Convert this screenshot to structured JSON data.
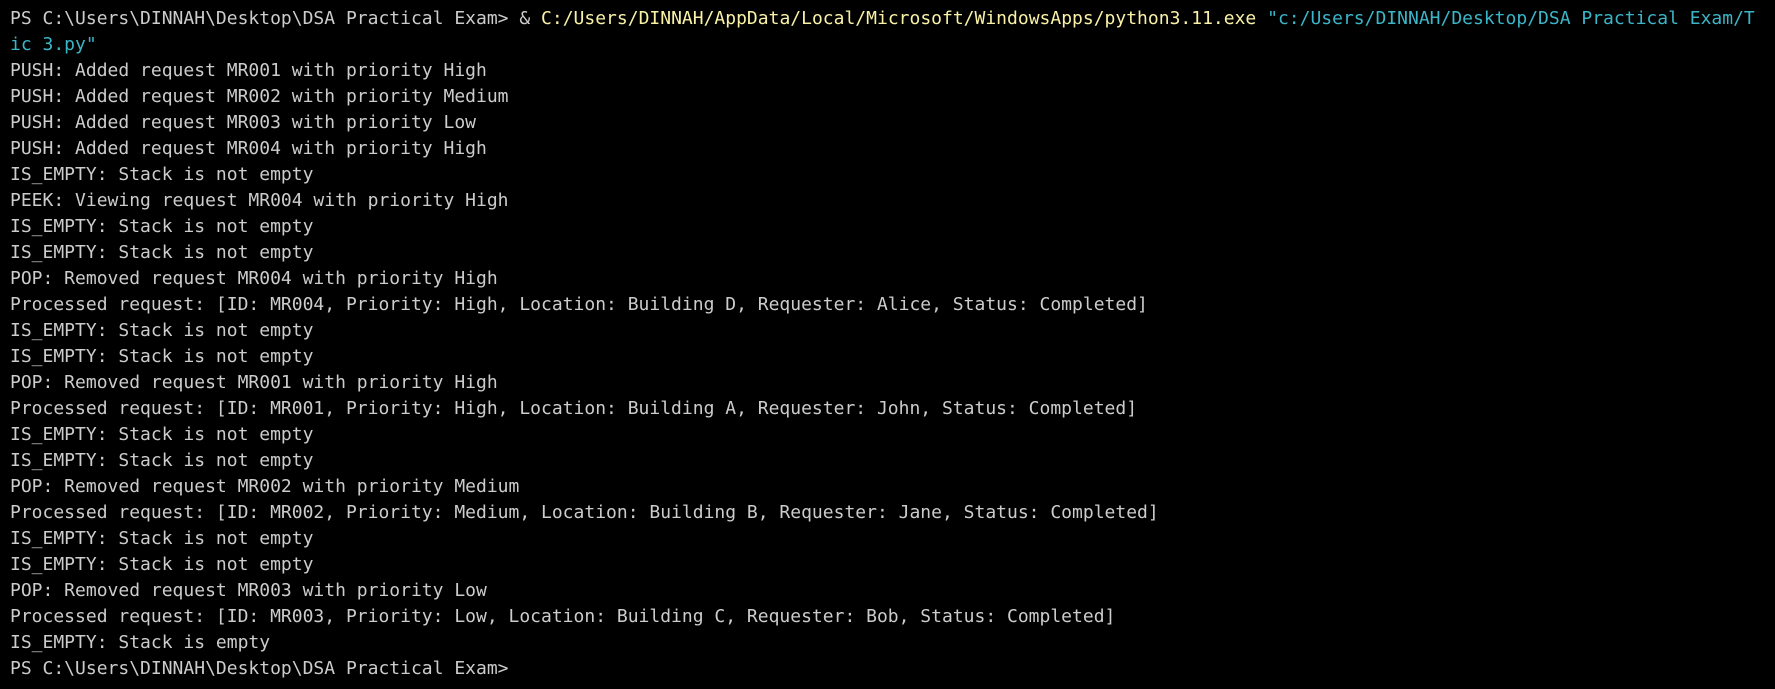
{
  "terminal": {
    "colors": {
      "background": "#000000",
      "text": "#cccccc",
      "executable": "#f9f1a5",
      "string": "#3bb6c9"
    },
    "command": {
      "prompt": "PS C:\\Users\\DINNAH\\Desktop\\DSA Practical Exam> ",
      "operator": "& ",
      "executable": "C:/Users/DINNAH/AppData/Local/Microsoft/WindowsApps/python3.11.exe ",
      "argument": "\"c:/Users/DINNAH/Desktop/DSA Practical Exam/Topic 3.py\"",
      "argument_visible": [
        "\"c:/Users/DINNAH/Desktop/DSA Practical Exam/T",
        "ic 3.py\""
      ]
    },
    "output": [
      "PUSH: Added request MR001 with priority High",
      "PUSH: Added request MR002 with priority Medium",
      "PUSH: Added request MR003 with priority Low",
      "PUSH: Added request MR004 with priority High",
      "IS_EMPTY: Stack is not empty",
      "PEEK: Viewing request MR004 with priority High",
      "IS_EMPTY: Stack is not empty",
      "IS_EMPTY: Stack is not empty",
      "POP: Removed request MR004 with priority High",
      "Processed request: [ID: MR004, Priority: High, Location: Building D, Requester: Alice, Status: Completed]",
      "IS_EMPTY: Stack is not empty",
      "IS_EMPTY: Stack is not empty",
      "POP: Removed request MR001 with priority High",
      "Processed request: [ID: MR001, Priority: High, Location: Building A, Requester: John, Status: Completed]",
      "IS_EMPTY: Stack is not empty",
      "IS_EMPTY: Stack is not empty",
      "POP: Removed request MR002 with priority Medium",
      "Processed request: [ID: MR002, Priority: Medium, Location: Building B, Requester: Jane, Status: Completed]",
      "IS_EMPTY: Stack is not empty",
      "IS_EMPTY: Stack is not empty",
      "POP: Removed request MR003 with priority Low",
      "Processed request: [ID: MR003, Priority: Low, Location: Building C, Requester: Bob, Status: Completed]",
      "IS_EMPTY: Stack is empty"
    ],
    "final_prompt": "PS C:\\Users\\DINNAH\\Desktop\\DSA Practical Exam>"
  }
}
